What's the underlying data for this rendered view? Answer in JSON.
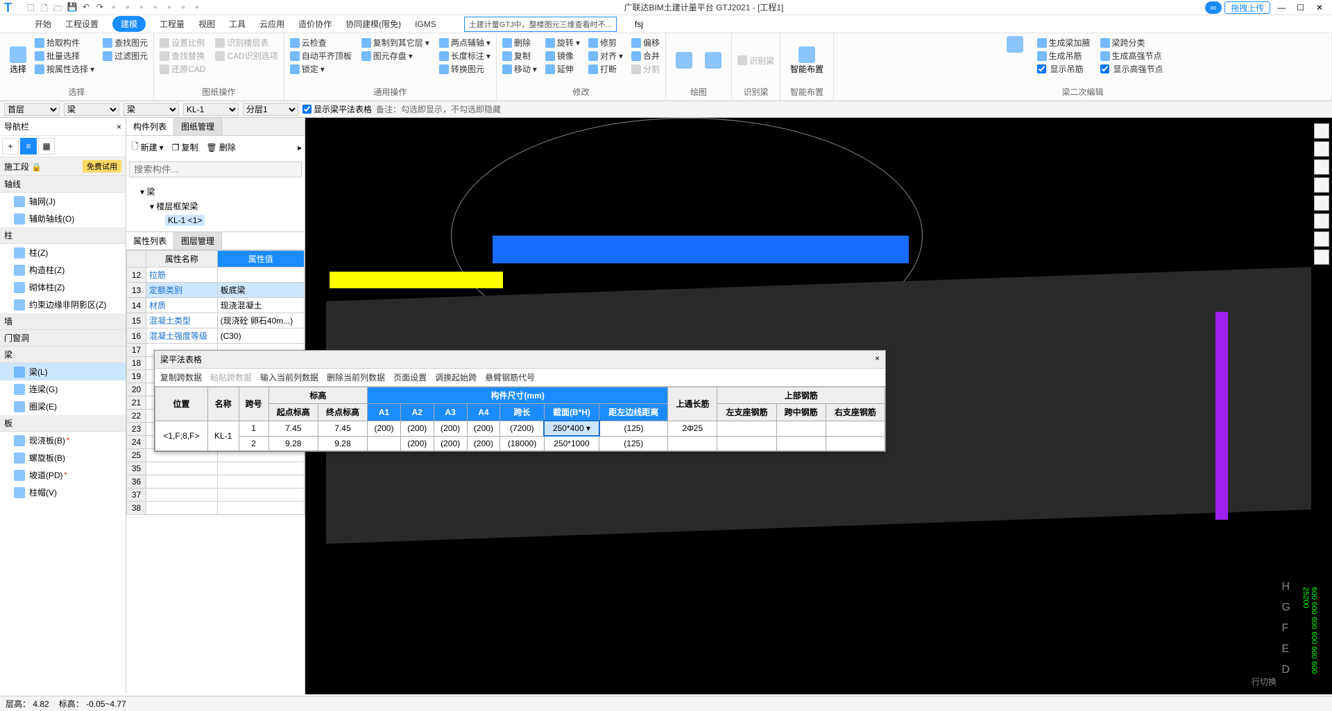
{
  "title": "广联达BIM土建计量平台 GTJ2021 - [工程1]",
  "upload_btn": "拖拽上传",
  "user": "fsj",
  "search_hint": "土建计量GTJ中，整楼图元三维查看时不...",
  "menus": [
    "开始",
    "工程设置",
    "建模",
    "工程量",
    "视图",
    "工具",
    "云应用",
    "造价协作",
    "协同建模(限免)",
    "IGMS"
  ],
  "active_menu": 2,
  "ribbon": {
    "g0_label": "选择",
    "g0_sel": "选择",
    "g0_cmds": [
      "拾取构件",
      "批量选择",
      "按属性选择"
    ],
    "g1_label": "选择",
    "g1_cmds": [
      "查找图元",
      "过滤图元"
    ],
    "g2_label": "图纸操作",
    "g2_cmds": [
      "设置比例",
      "查找替换",
      "还原CAD",
      "识别楼层表",
      "CAD识别选项"
    ],
    "g3_label": "通用操作",
    "g3_cmds": [
      "云检查",
      "自动平齐顶板",
      "锁定",
      "图元存盘",
      "复制到其它层",
      "两点辅轴",
      "长度标注",
      "转换图元"
    ],
    "g4_label": "修改",
    "g4_cmds": [
      "删除",
      "复制",
      "移动",
      "旋转",
      "镜像",
      "延伸",
      "修剪",
      "对齐",
      "打断",
      "偏移",
      "合并"
    ],
    "g5_label": "绘图",
    "g6_label": "识别梁",
    "g6_cmds": [
      "识别梁",
      "分割"
    ],
    "g7_label": "智能布置",
    "g7_big": "智能布置",
    "g8_label": "梁二次编辑",
    "g8_cmds": [
      "生成梁加腋",
      "生成吊筋",
      "显示吊筋",
      "梁跨分类",
      "生成高强节点",
      "显示高强节点"
    ]
  },
  "selectors": {
    "floor": "首层",
    "cat": "梁",
    "cat2": "梁",
    "comp": "KL-1",
    "layer": "分层1",
    "chk_label": "显示梁平法表格",
    "note": "备注：勾选即显示，不勾选即隐藏"
  },
  "nav": {
    "title": "导航栏",
    "section_title": "施工段",
    "trial": "免费试用",
    "cats": {
      "axis": "轴线",
      "axis_items": [
        "轴网(J)",
        "辅助轴线(O)"
      ],
      "col": "柱",
      "col_items": [
        "柱(Z)",
        "构造柱(Z)",
        "砌体柱(Z)",
        "约束边缘非阴影区(Z)"
      ],
      "wall": "墙",
      "door": "门窗洞",
      "beam": "梁",
      "beam_items": [
        "梁(L)",
        "连梁(G)",
        "圈梁(E)"
      ],
      "slab": "板",
      "slab_items": [
        "现浇板(B)",
        "螺旋板(B)",
        "坡道(PD)",
        "柱帽(V)"
      ]
    }
  },
  "complist": {
    "tabs": [
      "构件列表",
      "图纸管理"
    ],
    "btns": {
      "new": "新建",
      "copy": "复制",
      "del": "删除"
    },
    "search_ph": "搜索构件...",
    "tree": {
      "root": "梁",
      "lvl2": "楼层框架梁",
      "item": "KL-1 <1>"
    }
  },
  "proplist": {
    "tabs": [
      "属性列表",
      "图层管理"
    ],
    "hdrs": [
      "属性名称",
      "属性值"
    ],
    "rows": [
      {
        "n": "12",
        "name": "拉筋",
        "val": ""
      },
      {
        "n": "13",
        "name": "定额类别",
        "val": "板底梁"
      },
      {
        "n": "14",
        "name": "材质",
        "val": "现浇混凝土"
      },
      {
        "n": "15",
        "name": "混凝土类型",
        "val": "(现浇砼 卵石40m...)"
      },
      {
        "n": "16",
        "name": "混凝土强度等级",
        "val": "(C30)"
      }
    ],
    "more_rows": [
      "17",
      "18",
      "19",
      "20",
      "21",
      "22",
      "23",
      "24",
      "25",
      "35",
      "36",
      "37",
      "38"
    ]
  },
  "floatpanel": {
    "title": "梁平法表格",
    "toolbar": [
      "复制跨数据",
      "粘贴跨数据",
      "输入当前列数据",
      "删除当前列数据",
      "页面设置",
      "调换起始跨",
      "悬臂钢筋代号"
    ],
    "headers": {
      "pos": "位置",
      "name": "名称",
      "span": "跨号",
      "elev": "标高",
      "elev_s": "起点标高",
      "elev_e": "终点标高",
      "dims": "构件尺寸(mm)",
      "A1": "A1",
      "A2": "A2",
      "A3": "A3",
      "A4": "A4",
      "len": "跨长",
      "sec": "截面(B*H)",
      "left": "距左边线距离",
      "topbar": "上通长筋",
      "uprebar": "上部钢筋",
      "ls": "左支座钢筋",
      "mid": "跨中钢筋",
      "rs": "右支座钢筋"
    },
    "data": {
      "pos": "<1,F;8,F>",
      "name": "KL-1",
      "rows": [
        {
          "span": "1",
          "s": "7.45",
          "e": "7.45",
          "a1": "(200)",
          "a2": "(200)",
          "a3": "(200)",
          "a4": "(200)",
          "len": "(7200)",
          "sec": "250*400",
          "left": "(125)",
          "top": "2Φ25"
        },
        {
          "span": "2",
          "s": "9.28",
          "e": "9.28",
          "a1": "",
          "a2": "(200)",
          "a3": "(200)",
          "a4": "(200)",
          "len": "(18000)",
          "sec": "250*1000",
          "left": "(125)",
          "top": ""
        }
      ]
    }
  },
  "statusbar": {
    "floor_h": "层高：",
    "floor_hv": "4.82",
    "elev": "标高：",
    "elev_v": "-0.05~4.77",
    "switch": "行切换"
  }
}
